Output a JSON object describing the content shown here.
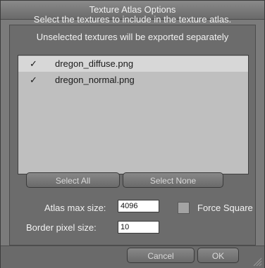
{
  "dialog": {
    "title": "Texture Atlas Options",
    "description_line1": "Select the textures to include in the texture atlas.",
    "description_line2": "Unselected textures will be exported separately"
  },
  "textures": [
    {
      "checked": true,
      "check_glyph": "✓",
      "name": "dregon_diffuse.png"
    },
    {
      "checked": true,
      "check_glyph": "✓",
      "name": "dregon_normal.png"
    }
  ],
  "buttons": {
    "select_all": "Select All",
    "select_none": "Select None",
    "cancel": "Cancel",
    "ok": "OK"
  },
  "settings": {
    "atlas_max_size_label": "Atlas max size:",
    "atlas_max_size_value": "4096",
    "border_pixel_size_label": "Border pixel size:",
    "border_pixel_size_value": "10",
    "force_square_label": "Force Square",
    "force_square_checked": false
  },
  "icons": {
    "check": "check-icon",
    "resize_grip": "resize-grip-icon"
  },
  "colors": {
    "dialog_bg": "#7b7b7b",
    "list_bg": "#bfbfbf",
    "list_selected_row": "#d7d7d7",
    "text_light": "#f2f2f2",
    "button_text": "#d9d9d9"
  }
}
